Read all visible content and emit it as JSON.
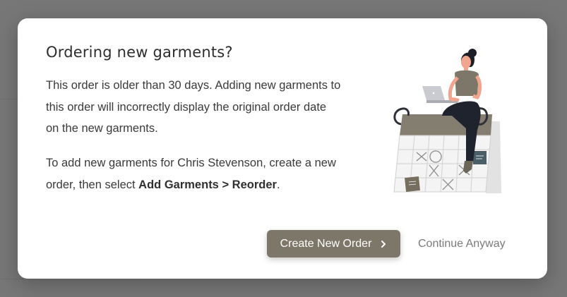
{
  "dialog": {
    "title": "Ordering new garments?",
    "paragraph1": "This order is older than 30 days. Adding new garments to this order will incorrectly display the original order date on the new garments.",
    "paragraph2_prefix": "To add new garments for Chris Stevenson, create a new order, then select ",
    "paragraph2_bold": "Add Garments > Reorder",
    "paragraph2_suffix": ".",
    "primary_button_label": "Create New Order",
    "primary_button_icon": "chevron-right-icon",
    "secondary_button_label": "Continue Anyway",
    "illustration": "woman-with-laptop-on-calendar-illustration"
  },
  "colors": {
    "primary_button": "#7d7769",
    "calendar_header": "#847e70",
    "calendar_note": "#4a5e68",
    "backdrop": "#777777"
  }
}
